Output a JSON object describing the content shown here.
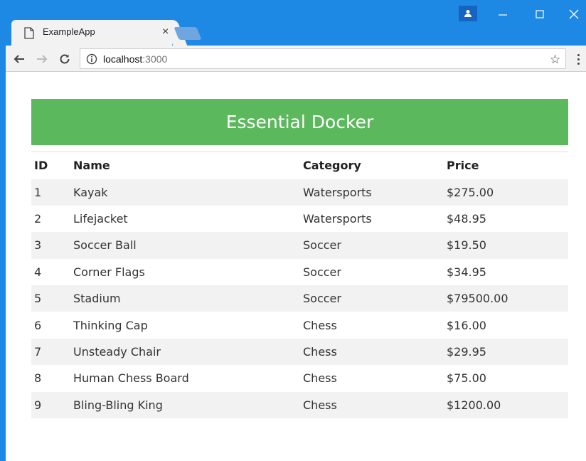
{
  "browser": {
    "tab_title": "ExampleApp",
    "tab_close": "×",
    "url_host": "localhost",
    "url_port": ":3000",
    "bookmark_star": "☆"
  },
  "page": {
    "title": "Essential Docker",
    "table": {
      "headers": [
        "ID",
        "Name",
        "Category",
        "Price"
      ],
      "rows": [
        [
          "1",
          "Kayak",
          "Watersports",
          "$275.00"
        ],
        [
          "2",
          "Lifejacket",
          "Watersports",
          "$48.95"
        ],
        [
          "3",
          "Soccer Ball",
          "Soccer",
          "$19.50"
        ],
        [
          "4",
          "Corner Flags",
          "Soccer",
          "$34.95"
        ],
        [
          "5",
          "Stadium",
          "Soccer",
          "$79500.00"
        ],
        [
          "6",
          "Thinking Cap",
          "Chess",
          "$16.00"
        ],
        [
          "7",
          "Unsteady Chair",
          "Chess",
          "$29.95"
        ],
        [
          "8",
          "Human Chess Board",
          "Chess",
          "$75.00"
        ],
        [
          "9",
          "Bling-Bling King",
          "Chess",
          "$1200.00"
        ]
      ]
    }
  },
  "colors": {
    "chrome_blue": "#1e88e5",
    "banner_green": "#5cb85c",
    "stripe": "#f2f2f2"
  }
}
